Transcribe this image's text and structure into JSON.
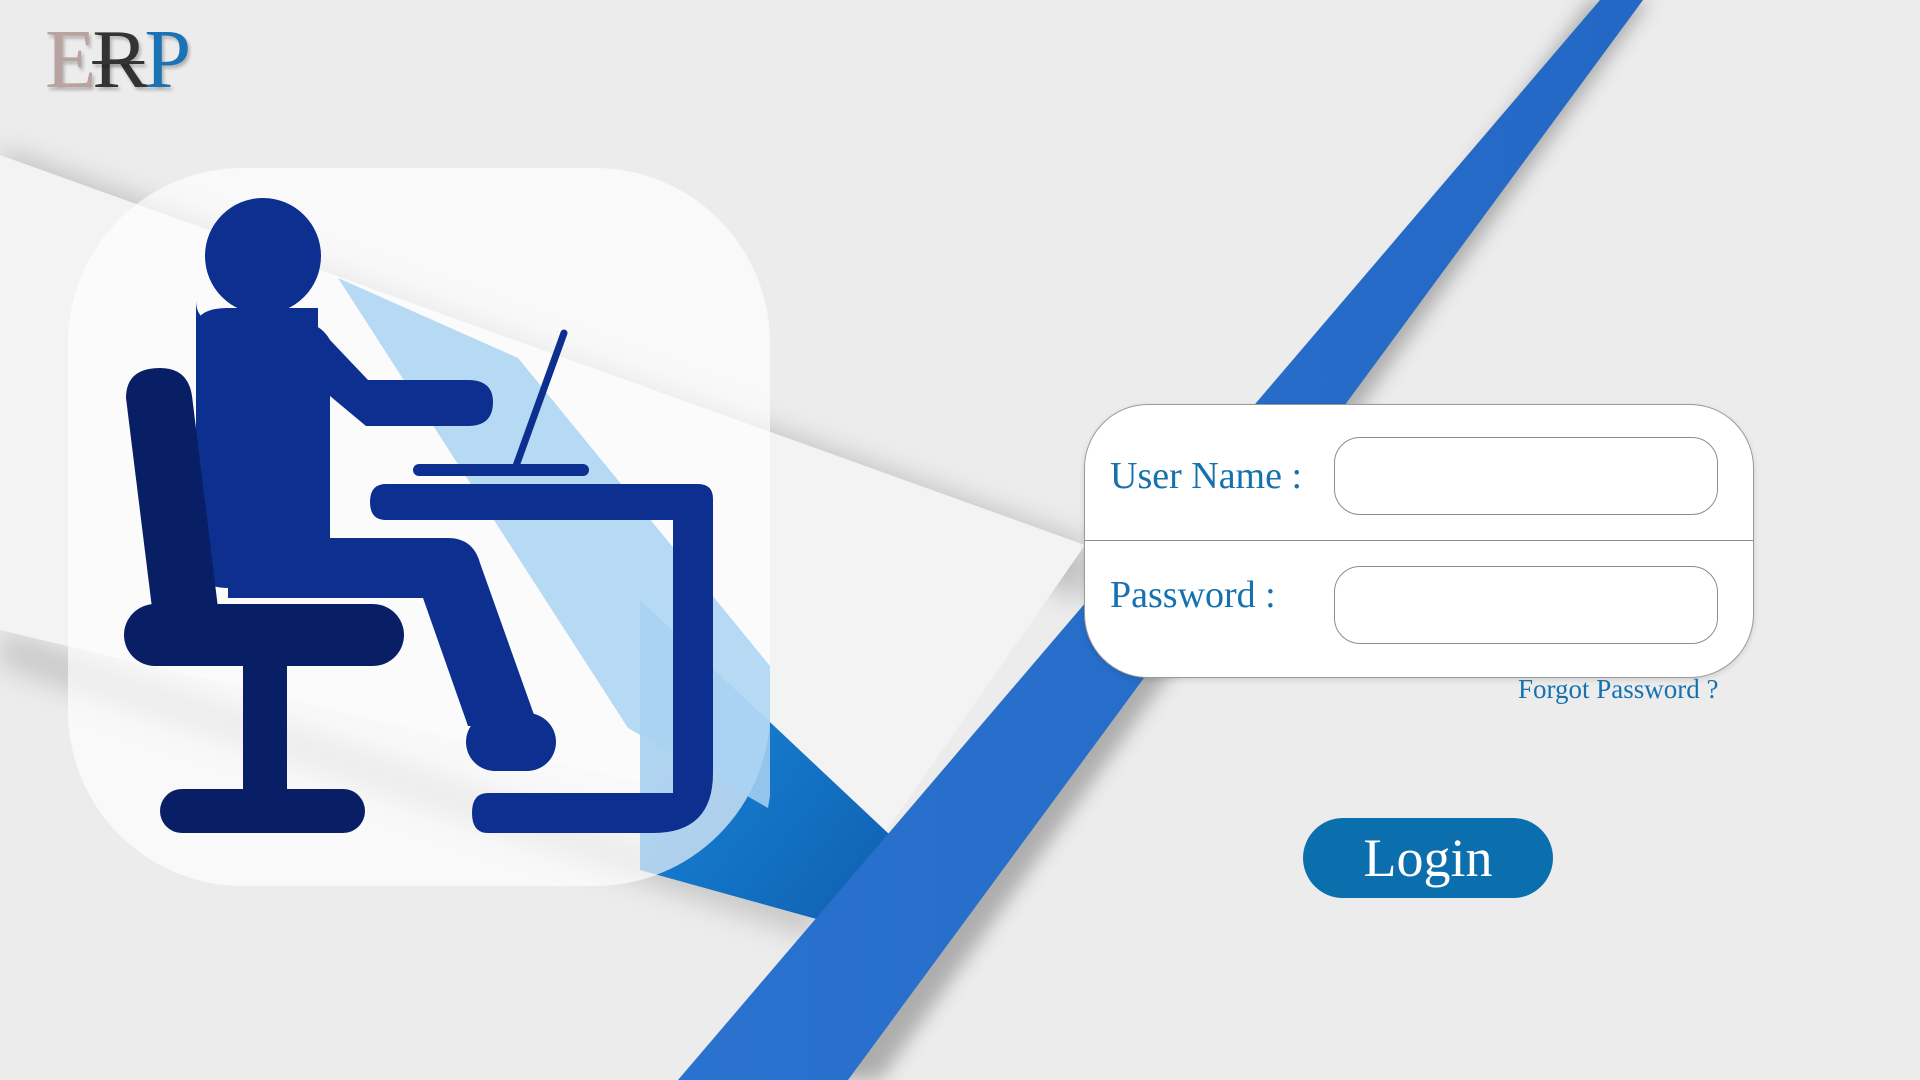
{
  "brand": {
    "logo_letters": [
      "E",
      "R",
      "P"
    ],
    "logo_colors": [
      "#b9a3a0",
      "#333333",
      "#1a73b5"
    ]
  },
  "illustration": {
    "icon": "person-at-desk-with-laptop-icon",
    "figure_color": "#0d2f8f",
    "chair_color": "#081f66"
  },
  "login_form": {
    "username_label": "User Name :",
    "username_value": "",
    "password_label": "Password :",
    "password_value": "",
    "forgot_password_label": "Forgot Password ?",
    "login_button_label": "Login"
  },
  "colors": {
    "accent_blue": "#2674cc",
    "text_blue": "#1572ae",
    "button_blue": "#0b6fae",
    "background": "#ececed"
  }
}
